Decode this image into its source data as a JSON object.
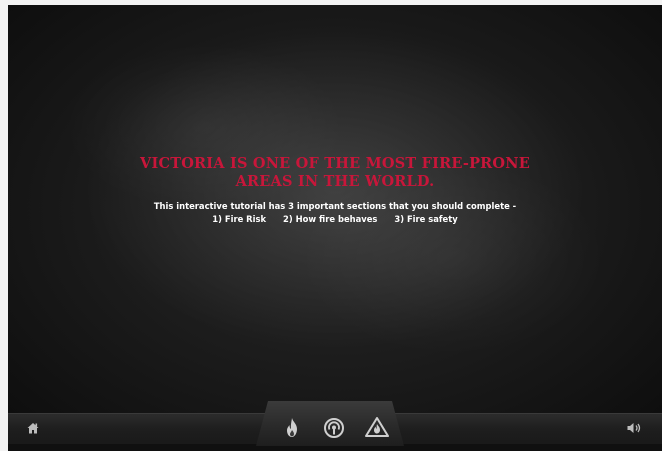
{
  "slide": {
    "headline_line1": "VICTORIA IS ONE OF THE MOST FIRE-PRONE",
    "headline_line2": "AREAS IN THE WORLD.",
    "intro": "This interactive tutorial has 3 important sections that you should complete -",
    "sections": [
      {
        "label": "1) Fire Risk"
      },
      {
        "label": "2) How fire behaves"
      },
      {
        "label": "3) Fire safety"
      }
    ]
  },
  "toolbar": {
    "left_icon": "home-icon",
    "center_icons": [
      "fire-icon",
      "signal-icon",
      "warning-icon"
    ],
    "right_icon": "sound-icon"
  },
  "colors": {
    "headline": "#c8163a",
    "text": "#ffffff",
    "background": "#1a1a1a",
    "icon": "#c9c9c9"
  }
}
